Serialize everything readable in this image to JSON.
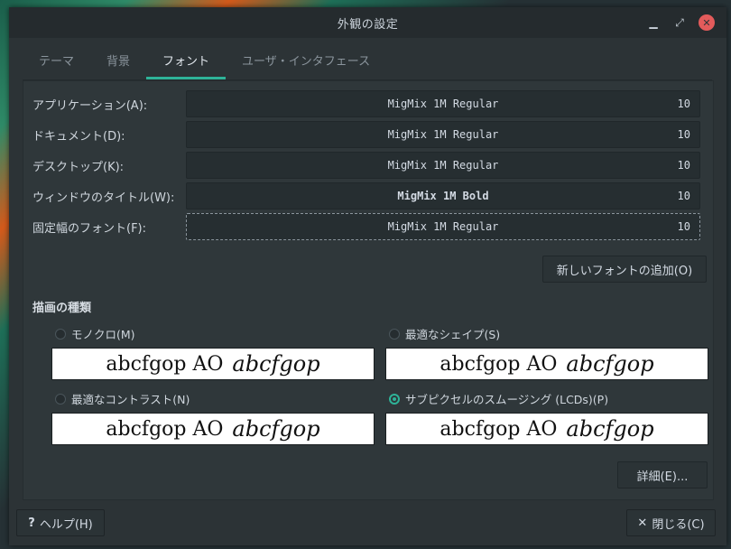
{
  "window": {
    "title": "外観の設定",
    "min_icon": "minimize-icon",
    "max_icon": "maximize-icon",
    "close_icon": "close-icon"
  },
  "tabs": [
    {
      "label": "テーマ",
      "active": false
    },
    {
      "label": "背景",
      "active": false
    },
    {
      "label": "フォント",
      "active": true
    },
    {
      "label": "ユーザ・インタフェース",
      "active": false
    }
  ],
  "fonts": [
    {
      "label": "アプリケーション(A):",
      "font": "MigMix 1M Regular",
      "size": "10"
    },
    {
      "label": "ドキュメント(D):",
      "font": "MigMix 1M Regular",
      "size": "10"
    },
    {
      "label": "デスクトップ(K):",
      "font": "MigMix 1M Regular",
      "size": "10"
    },
    {
      "label": "ウィンドウのタイトル(W):",
      "font": "MigMix 1M Bold",
      "size": "10"
    },
    {
      "label": "固定幅のフォント(F):",
      "font": "MigMix 1M Regular",
      "size": "10"
    }
  ],
  "add_font_button": "新しいフォントの追加(O)",
  "rendering": {
    "title": "描画の種類",
    "options": [
      {
        "label": "モノクロ(M)",
        "checked": false,
        "preview": "abcfgop AO",
        "preview_italic": "abcfgop"
      },
      {
        "label": "最適なシェイプ(S)",
        "checked": false,
        "preview": "abcfgop AO",
        "preview_italic": "abcfgop"
      },
      {
        "label": "最適なコントラスト(N)",
        "checked": false,
        "preview": "abcfgop AO",
        "preview_italic": "abcfgop"
      },
      {
        "label": "サブピクセルのスムージング (LCDs)(P)",
        "checked": true,
        "preview": "abcfgop AO",
        "preview_italic": "abcfgop"
      }
    ]
  },
  "details_button": "詳細(E)...",
  "help_button": {
    "label": "ヘルプ(H)",
    "icon": "help-icon",
    "glyph": "?"
  },
  "close_button": {
    "label": "閉じる(C)",
    "icon": "close-icon",
    "glyph": "✕"
  },
  "colors": {
    "accent": "#2eb398",
    "close": "#e35b5b"
  }
}
